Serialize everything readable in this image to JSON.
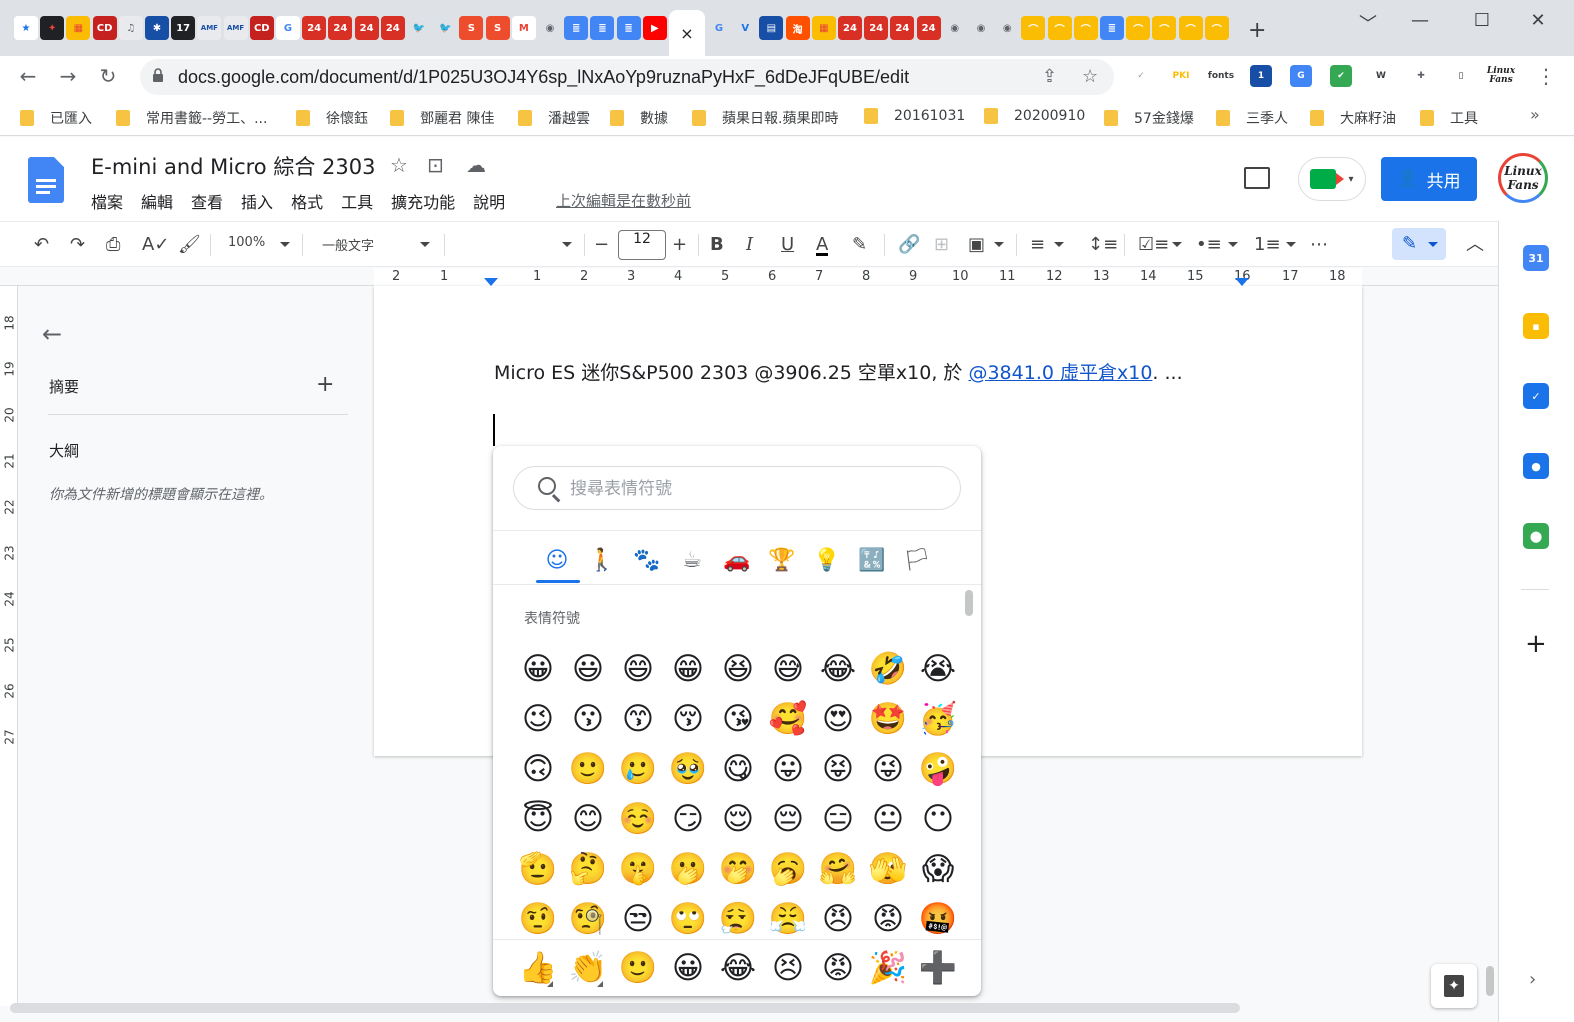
{
  "browser": {
    "tabs": [
      {
        "icon": "★",
        "bg": "#ffffff",
        "fg": "#1a73e8"
      },
      {
        "icon": "✦",
        "bg": "#202124",
        "fg": "#ea4335"
      },
      {
        "icon": "▦",
        "bg": "#fbbc04",
        "fg": "#ea4335"
      },
      {
        "icon": "CD",
        "bg": "#c5221f",
        "fg": "#ffffff"
      },
      {
        "icon": "♫",
        "bg": "#e8eaed",
        "fg": "#5f6368"
      },
      {
        "icon": "✱",
        "bg": "#174ea6",
        "fg": "#ffffff"
      },
      {
        "icon": "17",
        "bg": "#202124",
        "fg": "#ffffff"
      },
      {
        "icon": "AMF",
        "bg": "#e8eaed",
        "fg": "#174ea6"
      },
      {
        "icon": "AMF",
        "bg": "#e8eaed",
        "fg": "#174ea6"
      },
      {
        "icon": "CD",
        "bg": "#c5221f",
        "fg": "#ffffff"
      },
      {
        "icon": "G",
        "bg": "#ffffff",
        "fg": "#4285f4"
      },
      {
        "icon": "24",
        "bg": "#d93025",
        "fg": "#ffffff"
      },
      {
        "icon": "24",
        "bg": "#d93025",
        "fg": "#ffffff"
      },
      {
        "icon": "24",
        "bg": "#d93025",
        "fg": "#ffffff"
      },
      {
        "icon": "24",
        "bg": "#d93025",
        "fg": "#ffffff"
      },
      {
        "icon": "🐦",
        "bg": "#dee1e6",
        "fg": "#1d9bf0"
      },
      {
        "icon": "🐦",
        "bg": "#dee1e6",
        "fg": "#1d9bf0"
      },
      {
        "icon": "S",
        "bg": "#ee4d2d",
        "fg": "#ffffff"
      },
      {
        "icon": "S",
        "bg": "#ee4d2d",
        "fg": "#ffffff"
      },
      {
        "icon": "M",
        "bg": "#ffffff",
        "fg": "#ea4335"
      },
      {
        "icon": "◉",
        "bg": "#dee1e6",
        "fg": "#5f6368"
      },
      {
        "icon": "≣",
        "bg": "#4285f4",
        "fg": "#ffffff"
      },
      {
        "icon": "≣",
        "bg": "#4285f4",
        "fg": "#ffffff"
      },
      {
        "icon": "≣",
        "bg": "#4285f4",
        "fg": "#ffffff"
      },
      {
        "icon": "▶",
        "bg": "#ff0000",
        "fg": "#ffffff"
      },
      {
        "icon": "G",
        "bg": "#dee1e6",
        "fg": "#4285f4"
      },
      {
        "icon": "V",
        "bg": "#dee1e6",
        "fg": "#1a73e8"
      },
      {
        "icon": "▤",
        "bg": "#174ea6",
        "fg": "#ffffff"
      },
      {
        "icon": "淘",
        "bg": "#ff5000",
        "fg": "#ffffff"
      },
      {
        "icon": "▦",
        "bg": "#fbbc04",
        "fg": "#ea4335"
      },
      {
        "icon": "24",
        "bg": "#d93025",
        "fg": "#ffffff"
      },
      {
        "icon": "24",
        "bg": "#d93025",
        "fg": "#ffffff"
      },
      {
        "icon": "24",
        "bg": "#d93025",
        "fg": "#ffffff"
      },
      {
        "icon": "24",
        "bg": "#d93025",
        "fg": "#ffffff"
      },
      {
        "icon": "◉",
        "bg": "#dee1e6",
        "fg": "#5f6368"
      },
      {
        "icon": "◉",
        "bg": "#dee1e6",
        "fg": "#5f6368"
      },
      {
        "icon": "◉",
        "bg": "#dee1e6",
        "fg": "#5f6368"
      },
      {
        "icon": "⌒",
        "bg": "#fbbc04",
        "fg": "#ffffff"
      },
      {
        "icon": "⌒",
        "bg": "#fbbc04",
        "fg": "#ffffff"
      },
      {
        "icon": "⌒",
        "bg": "#fbbc04",
        "fg": "#ffffff"
      },
      {
        "icon": "≣",
        "bg": "#4285f4",
        "fg": "#ffffff"
      },
      {
        "icon": "⌒",
        "bg": "#fbbc04",
        "fg": "#ffffff"
      },
      {
        "icon": "⌒",
        "bg": "#fbbc04",
        "fg": "#ffffff"
      },
      {
        "icon": "⌒",
        "bg": "#fbbc04",
        "fg": "#ffffff"
      },
      {
        "icon": "⌒",
        "bg": "#fbbc04",
        "fg": "#ffffff"
      }
    ],
    "active_tab_close": "×",
    "new_tab": "+",
    "window_controls": [
      "﹀",
      "—",
      "☐",
      "✕"
    ],
    "url": "docs.google.com/document/d/1P025U3OJ4Y6sp_lNxAoYp9ruznaPyHxF_6dDeJFqUBE/edit",
    "extensions": [
      {
        "label": "✓",
        "bg": "#ffffff",
        "fg": "#9aa0a6"
      },
      {
        "label": "PKI",
        "bg": "#ffffff",
        "fg": "#fbbc04"
      },
      {
        "label": "fonts",
        "bg": "#ffffff",
        "fg": "#3c4043"
      },
      {
        "label": "1",
        "bg": "#174ea6",
        "fg": "#ffffff"
      },
      {
        "label": "G",
        "bg": "#4285f4",
        "fg": "#ffffff"
      },
      {
        "label": "✔",
        "bg": "#34a853",
        "fg": "#ffffff"
      },
      {
        "label": "W",
        "bg": "#ffffff",
        "fg": "#3c4043"
      },
      {
        "label": "✚",
        "bg": "#ffffff",
        "fg": "#5f6368"
      },
      {
        "label": "▯",
        "bg": "#ffffff",
        "fg": "#3c4043"
      }
    ],
    "profile_label": "Linux Fans",
    "bookmarks": [
      "已匯入",
      "常用書籤--勞工、...",
      "徐懷鈺",
      "鄧麗君 陳佳",
      "潘越雲",
      "數據",
      "蘋果日報.蘋果即時",
      "20161031",
      "20200910",
      "57金錢爆",
      "三季人",
      "大麻籽油",
      "工具"
    ],
    "bookmarks_more": "»"
  },
  "docs": {
    "title": "E-mini and Micro 綜合 2303",
    "menu": [
      "檔案",
      "編輯",
      "查看",
      "插入",
      "格式",
      "工具",
      "擴充功能",
      "說明"
    ],
    "last_edit": "上次編輯是在數秒前",
    "share_label": "共用",
    "avatar_text": "Linux Fans",
    "toolbar": {
      "zoom": "100%",
      "style": "一般文字",
      "font_size": "12"
    },
    "ruler_numbers": [
      "2",
      "1",
      "1",
      "2",
      "3",
      "4",
      "5",
      "6",
      "7",
      "8",
      "9",
      "10",
      "11",
      "12",
      "13",
      "14",
      "15",
      "16",
      "17",
      "18"
    ],
    "vruler_numbers": [
      "18",
      "19",
      "20",
      "21",
      "22",
      "23",
      "24",
      "25",
      "26",
      "27"
    ],
    "outline": {
      "summary": "摘要",
      "outline": "大綱",
      "hint": "你為文件新增的標題會顯示在這裡。"
    },
    "body": {
      "text_before": "Micro ES 迷你S&P500 2303 @3906.25 空單x10, 於 ",
      "link": "@3841.0 虛平倉x10",
      "text_after": ". ..."
    }
  },
  "emoji_picker": {
    "search_placeholder": "搜尋表情符號",
    "categories": [
      "☺",
      "🚶",
      "🐾",
      "☕",
      "🚗",
      "🏆",
      "💡",
      "🔣",
      "🏳"
    ],
    "section_label": "表情符號",
    "emojis": [
      "😀",
      "😃",
      "😄",
      "😁",
      "😆",
      "😅",
      "😂",
      "🤣",
      "😭",
      "😉",
      "😗",
      "😙",
      "😚",
      "😘",
      "🥰",
      "😍",
      "🤩",
      "🥳",
      "🙃",
      "🙂",
      "🥲",
      "🥹",
      "😋",
      "😛",
      "😝",
      "😜",
      "🤪",
      "😇",
      "😊",
      "☺️",
      "😏",
      "😌",
      "😔",
      "😑",
      "😐",
      "😶",
      "🫡",
      "🤔",
      "🤫",
      "🫢",
      "🤭",
      "🥱",
      "🤗",
      "🫣",
      "😱",
      "🤨",
      "🧐",
      "😒",
      "🙄",
      "😮‍💨",
      "😤",
      "😠",
      "😡",
      "🤬"
    ],
    "recent": [
      "👍",
      "👏",
      "🙂",
      "😀",
      "😂",
      "😣",
      "😡",
      "🎉",
      "➕"
    ]
  },
  "side_panel": [
    {
      "name": "calendar-icon",
      "label": "31",
      "bg": "#4285f4"
    },
    {
      "name": "keep-icon",
      "label": "▪",
      "bg": "#fbbc04"
    },
    {
      "name": "tasks-icon",
      "label": "✓",
      "bg": "#1a73e8"
    },
    {
      "name": "contacts-icon",
      "label": "●",
      "bg": "#1a73e8"
    },
    {
      "name": "maps-icon",
      "label": "⬤",
      "bg": "#34a853"
    }
  ]
}
